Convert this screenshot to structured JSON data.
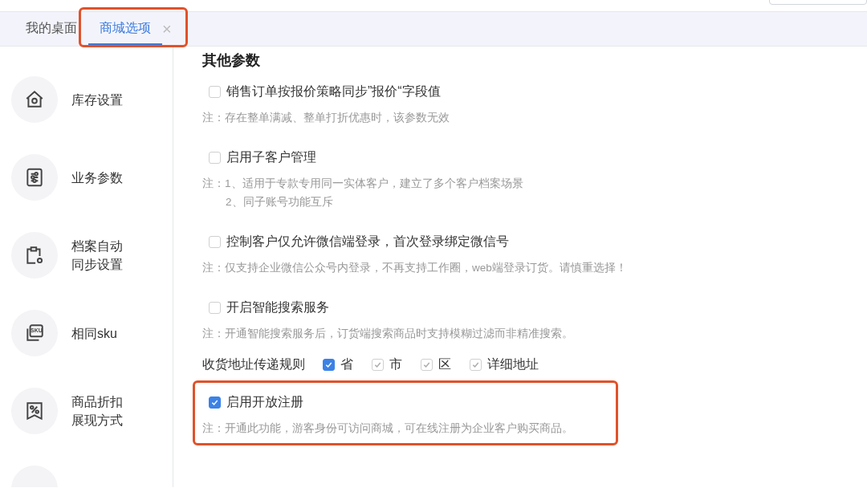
{
  "tabs": [
    {
      "label": "我的桌面",
      "selected": false,
      "closable": false,
      "highlighted": false
    },
    {
      "label": "商城选项",
      "selected": true,
      "closable": true,
      "highlighted": true
    }
  ],
  "close_glyph": "×",
  "sidebar": {
    "items": [
      {
        "kind": "house",
        "label": "库存设置"
      },
      {
        "kind": "sliders",
        "label": "业务参数"
      },
      {
        "kind": "clipboard",
        "label": [
          "档案自动",
          "同步设置"
        ]
      },
      {
        "kind": "sku",
        "label": "相同sku",
        "icon_text": "SKU"
      },
      {
        "kind": "percent",
        "label": [
          "商品折扣",
          "展现方式"
        ]
      },
      {
        "kind": "partial"
      }
    ]
  },
  "section_title": "其他参数",
  "options": [
    {
      "kind": "checkbox",
      "label": "销售订单按报价策略同步”报价“字段值",
      "checked": false,
      "highlighted": false,
      "notes": [
        "注：存在整单满减、整单打折优惠时，该参数无效"
      ]
    },
    {
      "kind": "checkbox",
      "label": "启用子客户管理",
      "checked": false,
      "highlighted": false,
      "notes": [
        "注：1、适用于专款专用同一实体客户，建立了多个客户档案场景",
        "2、同子账号功能互斥"
      ]
    },
    {
      "kind": "checkbox",
      "label": "控制客户仅允许微信端登录，首次登录绑定微信号",
      "checked": false,
      "highlighted": false,
      "notes": [
        "注：仅支持企业微信公众号内登录，不再支持工作圈，web端登录订货。请慎重选择！"
      ]
    },
    {
      "kind": "checkbox",
      "label": "开启智能搜索服务",
      "checked": false,
      "highlighted": false,
      "notes": [
        "注：开通智能搜索服务后，订货端搜索商品时支持模糊过滤而非精准搜索。"
      ]
    },
    {
      "kind": "address",
      "label": "收货地址传递规则",
      "choices": [
        {
          "label": "省",
          "checked": true,
          "disabled": false
        },
        {
          "label": "市",
          "checked": true,
          "disabled": true
        },
        {
          "label": "区",
          "checked": true,
          "disabled": true
        },
        {
          "label": "详细地址",
          "checked": true,
          "disabled": true
        }
      ]
    },
    {
      "kind": "checkbox",
      "label": "启用开放注册",
      "checked": true,
      "highlighted": true,
      "notes": [
        "注：开通此功能，游客身份可访问商城，可在线注册为企业客户购买商品。"
      ]
    }
  ]
}
